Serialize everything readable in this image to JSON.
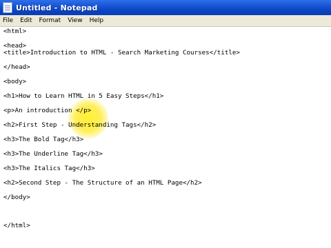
{
  "window": {
    "title": "Untitled - Notepad"
  },
  "menubar": {
    "items": [
      "File",
      "Edit",
      "Format",
      "View",
      "Help"
    ]
  },
  "editor": {
    "lines": [
      "<html>",
      "",
      "<head>",
      "<title>Introduction to HTML - Search Marketing Courses</title>",
      "",
      "</head>",
      "",
      "<body>",
      "",
      "<h1>How to Learn HTML in 5 Easy Steps</h1>",
      "",
      "<p>An introduction </p>",
      "",
      "<h2>First Step - Understanding Tags</h2>",
      "",
      "<h3>The Bold Tag</h3>",
      "",
      "<h3>The Underline Tag</h3>",
      "",
      "<h3>The Italics Tag</h3>",
      "",
      "<h2>Second Step - The Structure of an HTML Page</h2>",
      "",
      "</body>",
      "",
      "",
      "",
      "</html>"
    ]
  },
  "colors": {
    "titlebar": "#0b43c2",
    "menubar": "#ece9d8",
    "cursor_highlight": "#ffef28"
  }
}
